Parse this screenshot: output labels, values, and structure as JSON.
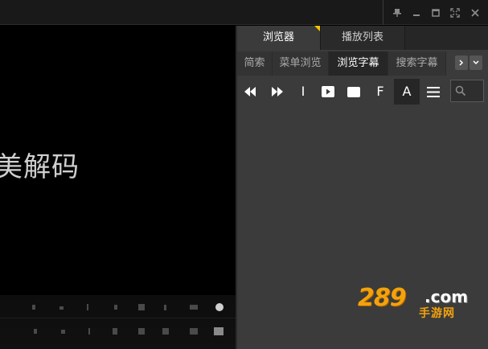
{
  "window": {
    "buttons": [
      "pin-icon",
      "minimize-icon",
      "maximize-icon",
      "fullscreen-icon",
      "close-icon"
    ]
  },
  "video": {
    "subtitle_text": "美解码"
  },
  "panel": {
    "main_tabs": [
      {
        "label": "浏览器",
        "active": true
      },
      {
        "label": "播放列表",
        "active": false
      }
    ],
    "sub_tabs": [
      {
        "label": "简索",
        "active": false
      },
      {
        "label": "菜单浏览",
        "active": false
      },
      {
        "label": "浏览字幕",
        "active": true
      },
      {
        "label": "搜索字幕",
        "active": false
      }
    ],
    "toolbar": {
      "letters": {
        "text_cursor": "I",
        "font": "F",
        "alpha": "A"
      }
    }
  },
  "watermark": {
    "number": "289",
    "domain": ".com",
    "sub": "手游网"
  },
  "colors": {
    "accent_flag": "#f5c400",
    "watermark_orange": "#f4a20c",
    "panel_bg": "#3b3b3b",
    "video_bg": "#000000"
  }
}
